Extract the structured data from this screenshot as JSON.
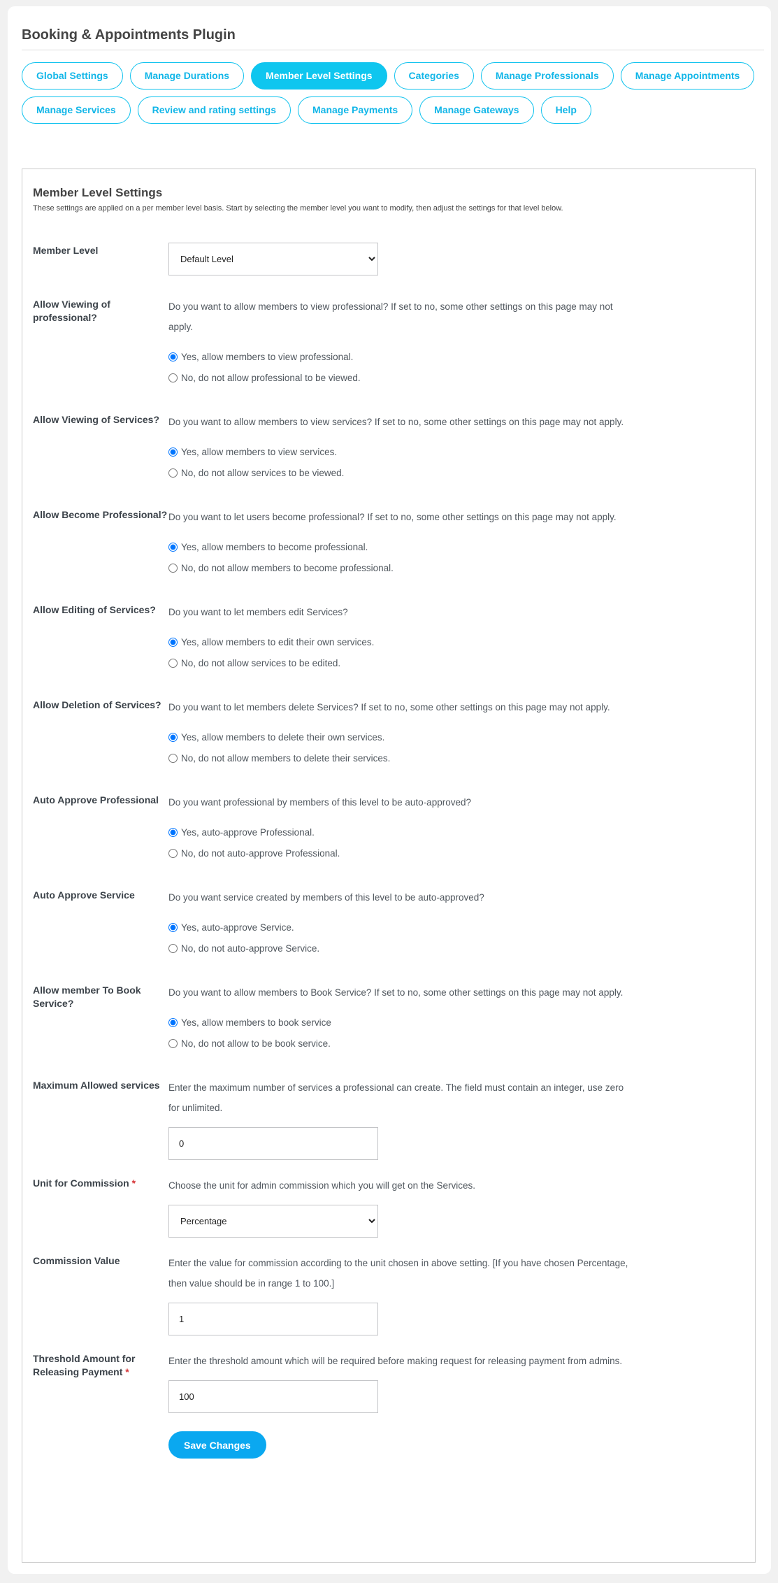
{
  "app_title": "Booking & Appointments Plugin",
  "tabs": [
    {
      "label": "Global Settings"
    },
    {
      "label": "Manage Durations"
    },
    {
      "label": "Member Level Settings",
      "active": true
    },
    {
      "label": "Categories"
    },
    {
      "label": "Manage Professionals"
    },
    {
      "label": "Manage Appointments"
    },
    {
      "label": "Manage Services"
    },
    {
      "label": "Review and rating settings"
    },
    {
      "label": "Manage Payments"
    },
    {
      "label": "Manage Gateways"
    },
    {
      "label": "Help"
    }
  ],
  "section": {
    "title": "Member Level Settings",
    "intro": "These settings are applied on a per member level basis. Start by selecting the member level you want to modify, then adjust the settings for that level below."
  },
  "member_level": {
    "label": "Member Level",
    "value": "Default Level"
  },
  "radio_settings": [
    {
      "label": "Allow Viewing of professional?",
      "desc": "Do you want to allow members to view professional? If set to no, some other settings on this page may not apply.",
      "yes": "Yes, allow members to view professional.",
      "no": "No, do not allow professional to be viewed.",
      "selected": "yes"
    },
    {
      "label": "Allow Viewing of Services?",
      "desc": "Do you want to allow members to view services? If set to no, some other settings on this page may not apply.",
      "yes": "Yes, allow members to view services.",
      "no": "No, do not allow services to be viewed.",
      "selected": "yes"
    },
    {
      "label": "Allow Become Professional?",
      "desc": "Do you want to let users become professional? If set to no, some other settings on this page may not apply.",
      "yes": "Yes, allow members to become professional.",
      "no": "No, do not allow members to become professional.",
      "selected": "yes"
    },
    {
      "label": "Allow Editing of Services?",
      "desc": "Do you want to let members edit Services?",
      "yes": "Yes, allow members to edit their own services.",
      "no": "No, do not allow services to be edited.",
      "selected": "yes"
    },
    {
      "label": "Allow Deletion of Services?",
      "desc": "Do you want to let members delete Services? If set to no, some other settings on this page may not apply.",
      "yes": "Yes, allow members to delete their own services.",
      "no": "No, do not allow members to delete their services.",
      "selected": "yes"
    },
    {
      "label": "Auto Approve Professional",
      "desc": "Do you want professional by members of this level to be auto-approved?",
      "yes": "Yes, auto-approve Professional.",
      "no": "No, do not auto-approve Professional.",
      "selected": "yes"
    },
    {
      "label": "Auto Approve Service",
      "desc": "Do you want service created by members of this level to be auto-approved?",
      "yes": "Yes, auto-approve Service.",
      "no": "No, do not auto-approve Service.",
      "selected": "yes"
    },
    {
      "label": "Allow member To Book Service?",
      "desc": "Do you want to allow members to Book Service? If set to no, some other settings on this page may not apply.",
      "yes": "Yes, allow members to book service",
      "no": "No, do not allow to be book service.",
      "selected": "yes"
    }
  ],
  "max_services": {
    "label": "Maximum Allowed services",
    "desc": "Enter the maximum number of services a professional can create. The field must contain an integer, use zero for unlimited.",
    "value": "0"
  },
  "commission_unit": {
    "label": "Unit for Commission",
    "required": "*",
    "desc": "Choose the unit for admin commission which you will get on the Services.",
    "value": "Percentage"
  },
  "commission_value": {
    "label": "Commission Value",
    "desc": "Enter the value for commission according to the unit chosen in above setting. [If you have chosen Percentage, then value should be in range 1 to 100.]",
    "value": "1"
  },
  "threshold": {
    "label": "Threshold Amount for Releasing Payment",
    "required": "*",
    "desc": "Enter the threshold amount which will be required before making request for releasing payment from admins.",
    "value": "100"
  },
  "save_label": "Save Changes",
  "colors": {
    "accent": "#0fc6ef",
    "save": "#0aa8f0",
    "radio": "#0075ff",
    "required": "#d63638"
  }
}
